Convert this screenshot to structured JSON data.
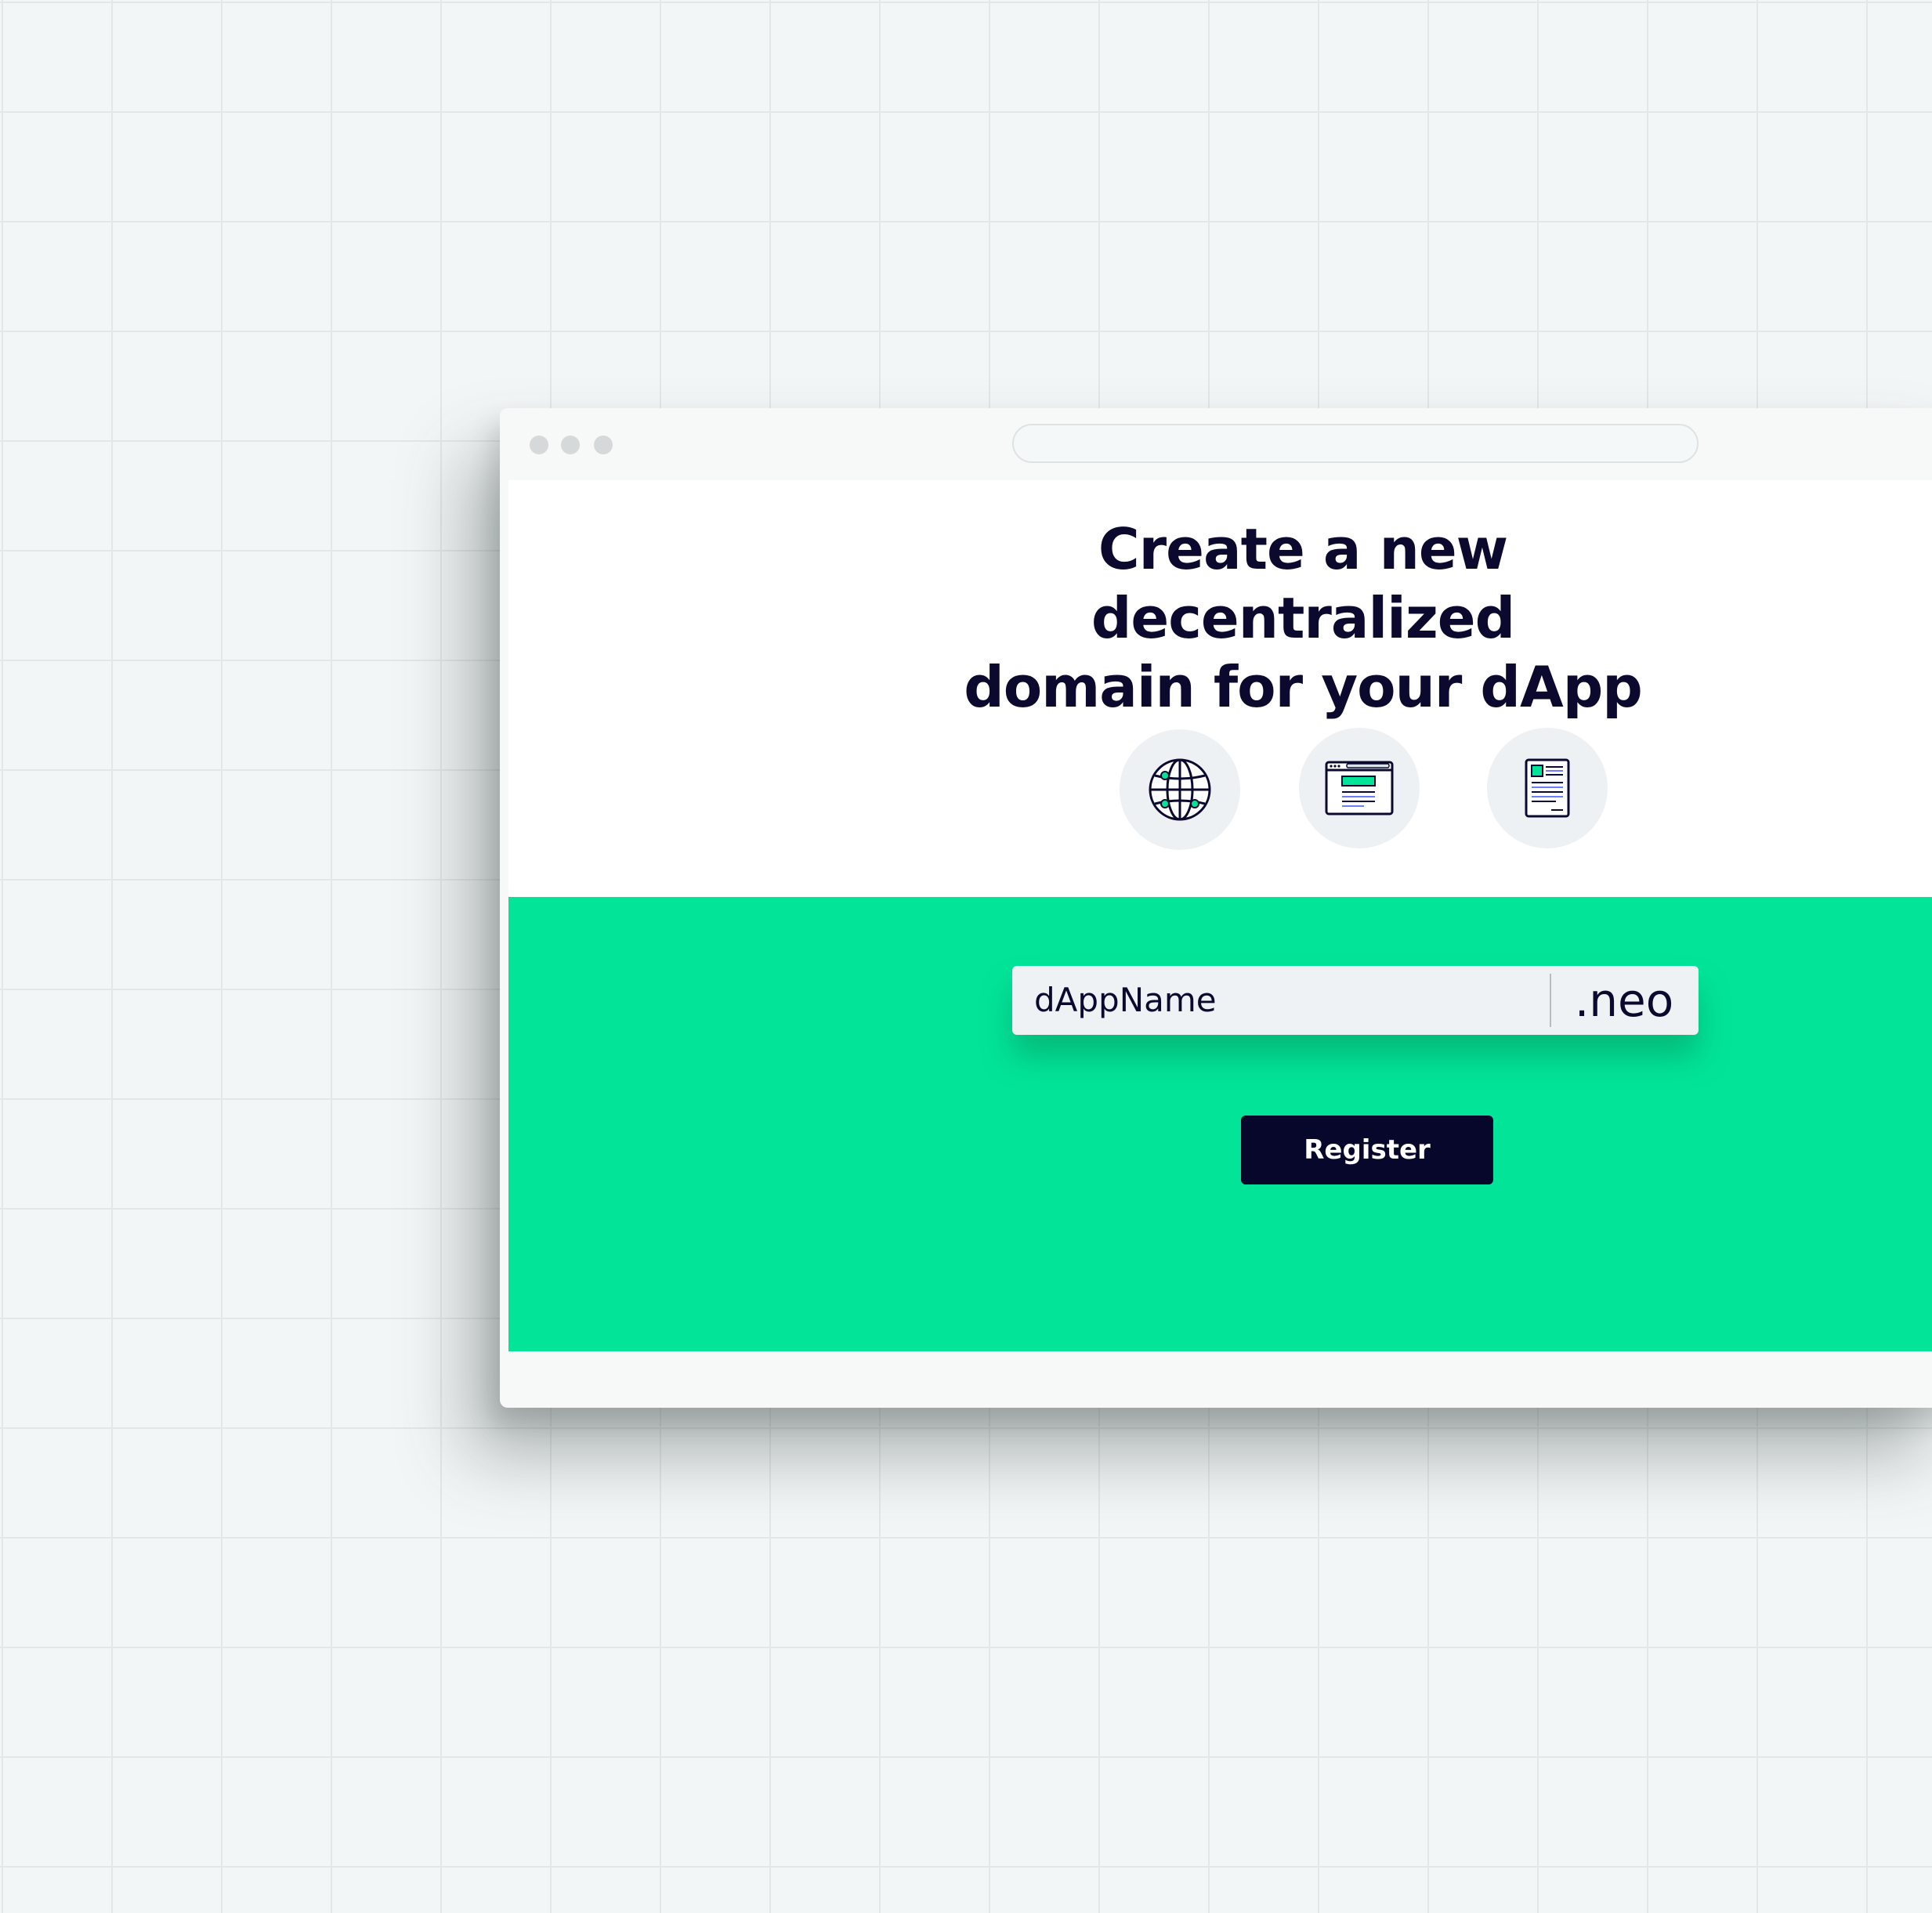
{
  "page": {
    "headline_line1": "Create a new decentralized",
    "headline_line2": "domain for your dApp"
  },
  "feature_icons": [
    "globe-icon",
    "webpage-icon",
    "document-icon"
  ],
  "form": {
    "domain_value": "dAppName",
    "tld": ".neo",
    "register_label": "Register"
  },
  "colors": {
    "accent_green": "#02e599",
    "dark_navy": "#07072b",
    "input_bg": "#eef2f4"
  }
}
